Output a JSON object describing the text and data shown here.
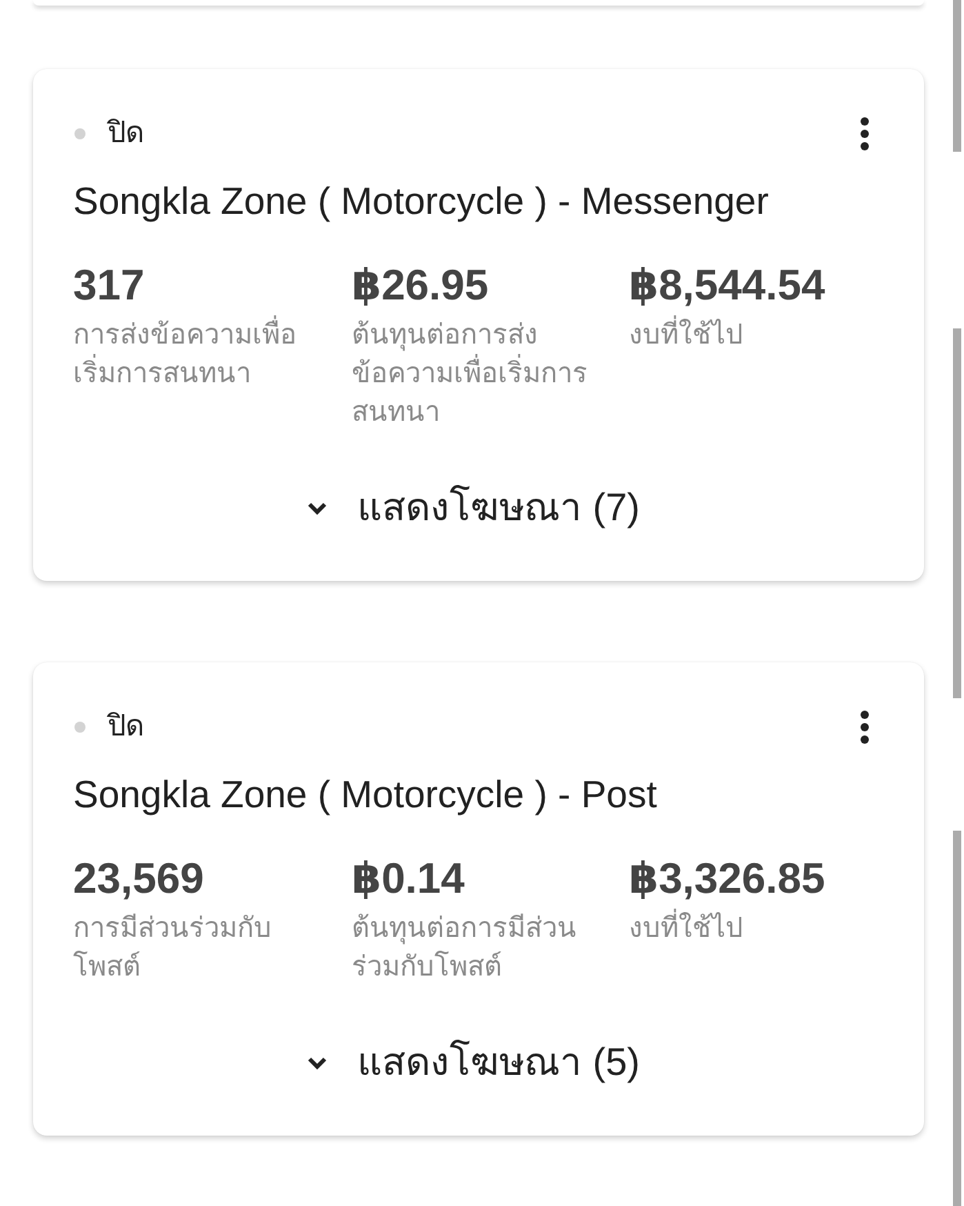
{
  "campaigns": [
    {
      "status": {
        "label": "ปิด",
        "active": false
      },
      "title": "Songkla Zone ( Motorcycle ) - Messenger",
      "metrics": [
        {
          "value": "317",
          "label": "การส่งข้อความเพื่อเริ่มการสนทนา"
        },
        {
          "value": "฿26.95",
          "label": "ต้นทุนต่อการส่งข้อความเพื่อเริ่มการสนทนา"
        },
        {
          "value": "฿8,544.54",
          "label": "งบที่ใช้ไป"
        }
      ],
      "ads_toggle": {
        "label": "แสดงโฆษณา (7)",
        "expanded": false
      }
    },
    {
      "status": {
        "label": "ปิด",
        "active": false
      },
      "title": "Songkla Zone ( Motorcycle ) - Post",
      "metrics": [
        {
          "value": "23,569",
          "label": "การมีส่วนร่วมกับโพสต์"
        },
        {
          "value": "฿0.14",
          "label": "ต้นทุนต่อการมีส่วนร่วมกับโพสต์"
        },
        {
          "value": "฿3,326.85",
          "label": "งบที่ใช้ไป"
        }
      ],
      "ads_toggle": {
        "label": "แสดงโฆษณา (5)",
        "expanded": false
      }
    }
  ]
}
